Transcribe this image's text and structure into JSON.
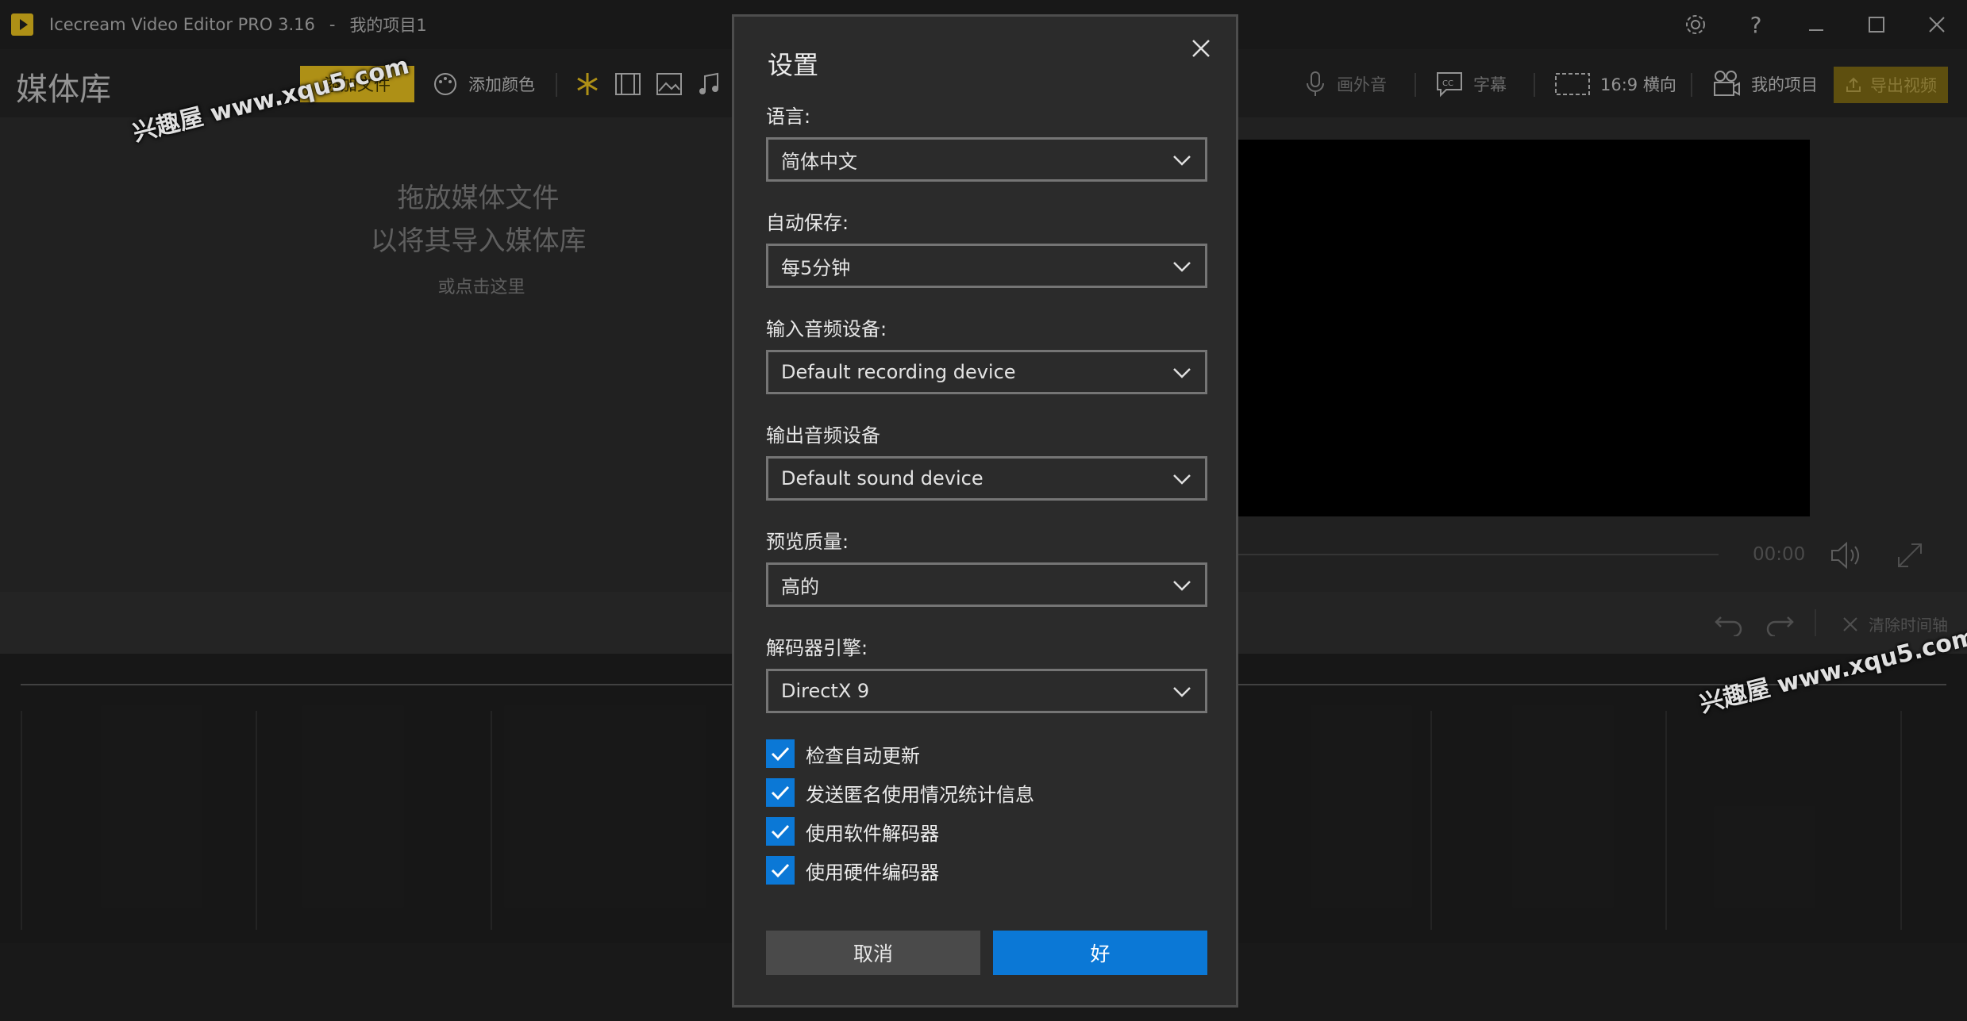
{
  "window": {
    "app_name": "Icecream Video Editor PRO 3.16",
    "separator": "-",
    "project_name": "我的项目1",
    "icons": [
      "settings-gear-icon",
      "help-icon",
      "minimize-icon",
      "maximize-icon",
      "close-icon"
    ]
  },
  "toolbar": {
    "library_title": "媒体库",
    "add_file": "添加文件",
    "add_color": "添加颜色",
    "voiceover": "画外音",
    "subtitles": "字幕",
    "aspect": "16:9 横向",
    "my_project": "我的项目",
    "export": "导出视频"
  },
  "media": {
    "drop_line1": "拖放媒体文件",
    "drop_line2": "以将其导入媒体库",
    "click_here": "或点击这里"
  },
  "preview": {
    "time": "00:00"
  },
  "timeline": {
    "clear": "清除时间轴"
  },
  "watermark": {
    "text": "兴趣屋 www.xqu5.com"
  },
  "dialog": {
    "title": "设置",
    "fields": [
      {
        "label": "语言:",
        "value": "简体中文"
      },
      {
        "label": "自动保存:",
        "value": "每5分钟"
      },
      {
        "label": "输入音频设备:",
        "value": "Default recording device"
      },
      {
        "label": "输出音频设备",
        "value": "Default sound device"
      },
      {
        "label": "预览质量:",
        "value": "高的"
      },
      {
        "label": "解码器引擎:",
        "value": "DirectX 9"
      }
    ],
    "checkboxes": [
      {
        "label": "检查自动更新",
        "checked": true
      },
      {
        "label": "发送匿名使用情况统计信息",
        "checked": true
      },
      {
        "label": "使用软件解码器",
        "checked": true
      },
      {
        "label": "使用硬件编码器",
        "checked": true
      }
    ],
    "cancel": "取消",
    "ok": "好"
  },
  "colors": {
    "accent_gold": "#c7a41a",
    "accent_blue": "#0b78d6"
  }
}
